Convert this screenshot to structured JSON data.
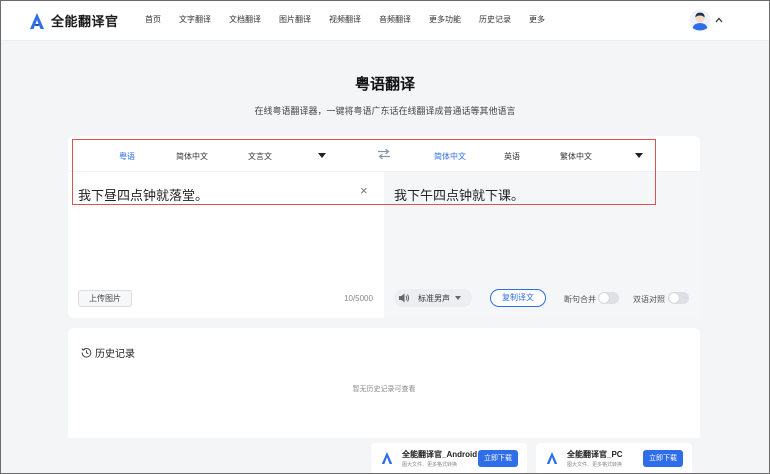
{
  "app": {
    "name": "全能翻译官"
  },
  "nav": {
    "items": [
      "首页",
      "文字翻译",
      "文档翻译",
      "图片翻译",
      "视频翻译",
      "音频翻译",
      "更多功能",
      "历史记录",
      "更多"
    ]
  },
  "hero": {
    "title": "粤语翻译",
    "subtitle": "在线粤语翻译器，一键将粤语广东话在线翻译成普通话等其他语言"
  },
  "translator": {
    "source_langs": [
      "粤语",
      "简体中文",
      "文言文"
    ],
    "target_langs": [
      "简体中文",
      "英语",
      "繁体中文"
    ],
    "source_text": "我下昼四点钟就落堂。",
    "target_text": "我下午四点钟就下课。",
    "clear_symbol": "×",
    "upload_label": "上传图片",
    "char_count": "10/5000",
    "voice_label": "标准男声",
    "copy_label": "复制译文",
    "toggle_split": "断句合并",
    "toggle_compare": "双语对照"
  },
  "history": {
    "title": "历史记录",
    "empty": "暂无历史记录可查看"
  },
  "downloads": [
    {
      "name": "全能翻译官_Android",
      "desc": "图大文件、更多格式转换",
      "button": "立即下载"
    },
    {
      "name": "全能翻译官_PC",
      "desc": "图大文件、更多格式转换",
      "button": "立即下载"
    }
  ],
  "colors": {
    "accent": "#2f6ee8",
    "highlight": "#d9534f",
    "background": "#f4f5f7"
  },
  "icons": [
    "logo-icon",
    "avatar-icon",
    "chevron-up-icon",
    "swap-icon",
    "dropdown-icon",
    "clear-icon",
    "speaker-icon",
    "history-icon"
  ]
}
